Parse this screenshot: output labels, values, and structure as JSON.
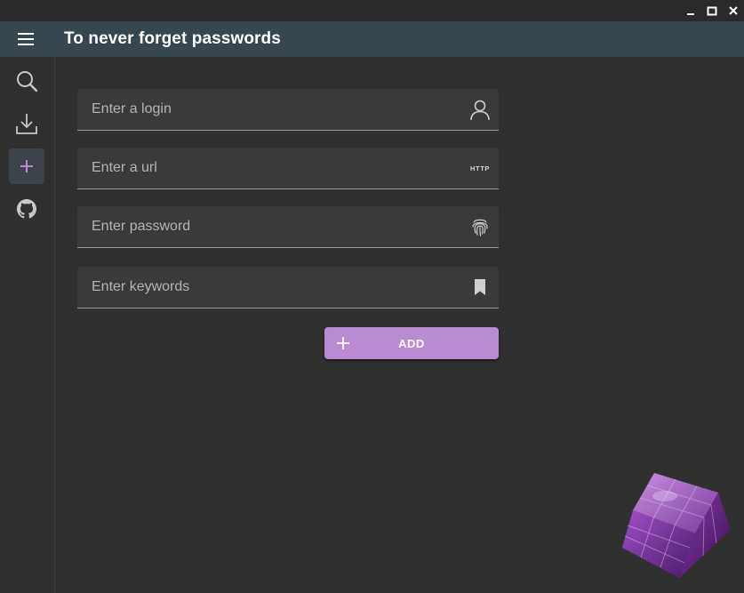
{
  "window": {
    "controls": [
      {
        "name": "minimize-button",
        "icon": "minimize-icon"
      },
      {
        "name": "maximize-button",
        "icon": "maximize-icon"
      },
      {
        "name": "close-button",
        "icon": "close-icon"
      }
    ]
  },
  "appbar": {
    "title": "To never forget passwords",
    "menu_icon": "hamburger-menu-icon",
    "color": "#37474f"
  },
  "sidebar": {
    "items": [
      {
        "name": "search",
        "icon": "search-icon",
        "active": false
      },
      {
        "name": "download",
        "icon": "download-icon",
        "active": false
      },
      {
        "name": "add",
        "icon": "plus-icon",
        "active": true
      },
      {
        "name": "github",
        "icon": "github-icon",
        "active": false
      }
    ]
  },
  "form": {
    "login": {
      "placeholder": "Enter a login",
      "value": "",
      "icon": "user-icon"
    },
    "url": {
      "placeholder": "Enter a url",
      "value": "",
      "icon": "http-icon",
      "icon_text": "HTTP"
    },
    "password": {
      "placeholder": "Enter password",
      "value": "",
      "icon": "fingerprint-icon"
    },
    "keywords": {
      "placeholder": "Enter keywords",
      "value": "",
      "icon": "bookmark-icon"
    }
  },
  "add_button": {
    "label": "ADD",
    "icon": "plus-icon",
    "color": "#ba8ad3"
  },
  "logo": {
    "icon": "purple-cube-logo"
  },
  "colors": {
    "background": "#303030",
    "accent": "#ba8ad3",
    "field_background": "#3a3a3a"
  }
}
